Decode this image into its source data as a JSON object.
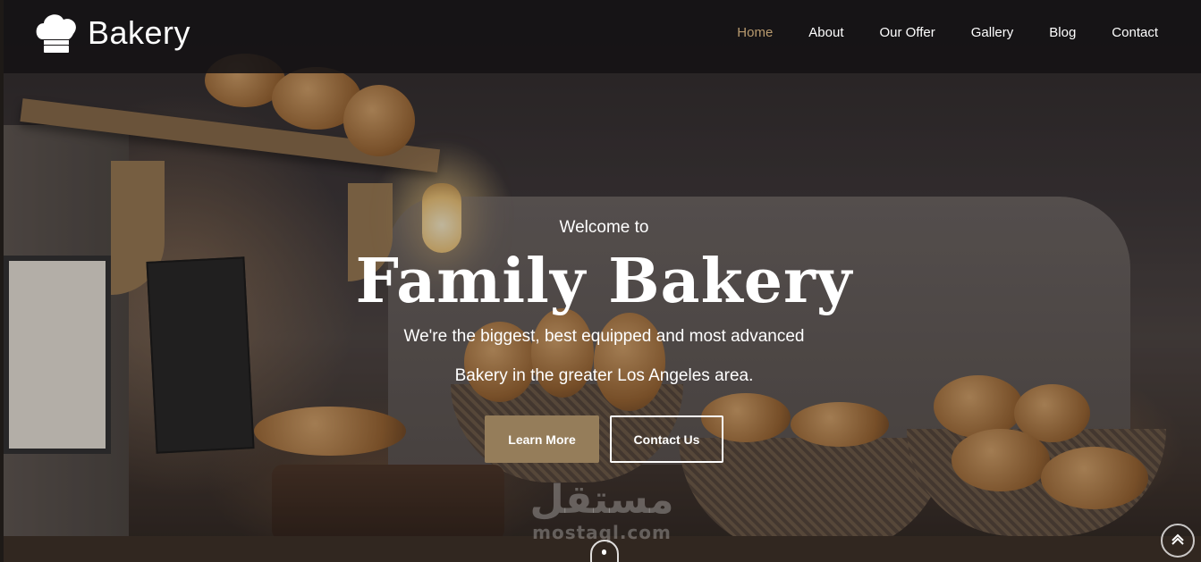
{
  "brand": {
    "name": "Bakery",
    "logo_icon": "chef-hat-icon"
  },
  "nav": {
    "items": [
      {
        "label": "Home",
        "active": true
      },
      {
        "label": "About",
        "active": false
      },
      {
        "label": "Our Offer",
        "active": false
      },
      {
        "label": "Gallery",
        "active": false
      },
      {
        "label": "Blog",
        "active": false
      },
      {
        "label": "Contact",
        "active": false
      }
    ]
  },
  "hero": {
    "welcome": "Welcome to",
    "title": "Family Bakery",
    "subtitle_line1": "We're the biggest, best equipped and most advanced",
    "subtitle_line2": "Bakery in the greater Los Angeles area.",
    "primary_button": "Learn More",
    "secondary_button": "Contact Us"
  },
  "watermark": {
    "arabic": "مستقل",
    "latin": "mostaql.com"
  },
  "colors": {
    "accent": "#957d5a",
    "nav_active": "#b89a6e",
    "navbar_bg": "#141214"
  },
  "icons": {
    "scroll": "mouse-scroll-icon",
    "back_to_top": "chevron-up-icon"
  }
}
